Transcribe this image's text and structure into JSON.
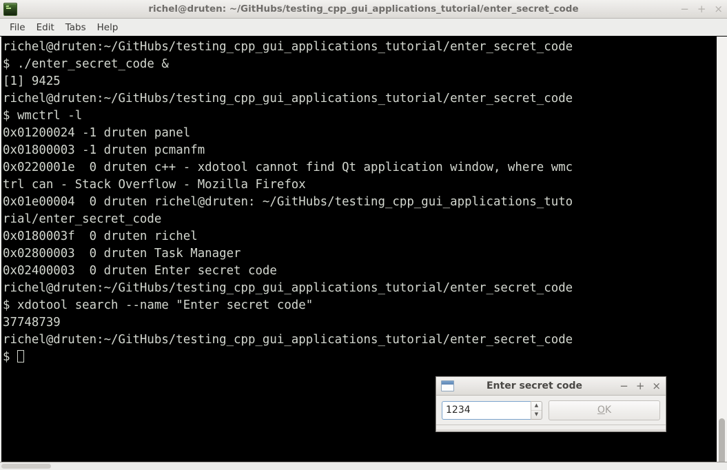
{
  "terminal": {
    "icon": "terminal-icon",
    "title": "richel@druten: ~/GitHubs/testing_cpp_gui_applications_tutorial/enter_secret_code",
    "window_controls": {
      "minimize": "−",
      "maximize": "+",
      "close": "×"
    },
    "menu": [
      {
        "label": "File"
      },
      {
        "label": "Edit"
      },
      {
        "label": "Tabs"
      },
      {
        "label": "Help"
      }
    ],
    "lines": [
      "richel@druten:~/GitHubs/testing_cpp_gui_applications_tutorial/enter_secret_code",
      "$ ./enter_secret_code &",
      "[1] 9425",
      "richel@druten:~/GitHubs/testing_cpp_gui_applications_tutorial/enter_secret_code",
      "$ wmctrl -l",
      "0x01200024 -1 druten panel",
      "0x01800003 -1 druten pcmanfm",
      "0x0220001e  0 druten c++ - xdotool cannot find Qt application window, where wmc",
      "trl can - Stack Overflow - Mozilla Firefox",
      "0x01e00004  0 druten richel@druten: ~/GitHubs/testing_cpp_gui_applications_tuto",
      "rial/enter_secret_code",
      "0x0180003f  0 druten richel",
      "0x02800003  0 druten Task Manager",
      "0x02400003  0 druten Enter secret code",
      "richel@druten:~/GitHubs/testing_cpp_gui_applications_tutorial/enter_secret_code",
      "$ xdotool search --name \"Enter secret code\"",
      "37748739",
      "richel@druten:~/GitHubs/testing_cpp_gui_applications_tutorial/enter_secret_code"
    ],
    "prompt_symbol": "$ ",
    "colors": {
      "background": "#000000",
      "foreground": "#d3d7cf",
      "chrome": "#ededeb"
    }
  },
  "dialog": {
    "icon": "window-icon",
    "title": "Enter secret code",
    "window_controls": {
      "minimize": "−",
      "maximize": "+",
      "close": "×"
    },
    "secret_input": {
      "value": "1234",
      "placeholder": ""
    },
    "spinner": {
      "up": "▲",
      "down": "▼"
    },
    "ok_button": {
      "accel": "O",
      "rest": "K",
      "enabled": false
    }
  }
}
